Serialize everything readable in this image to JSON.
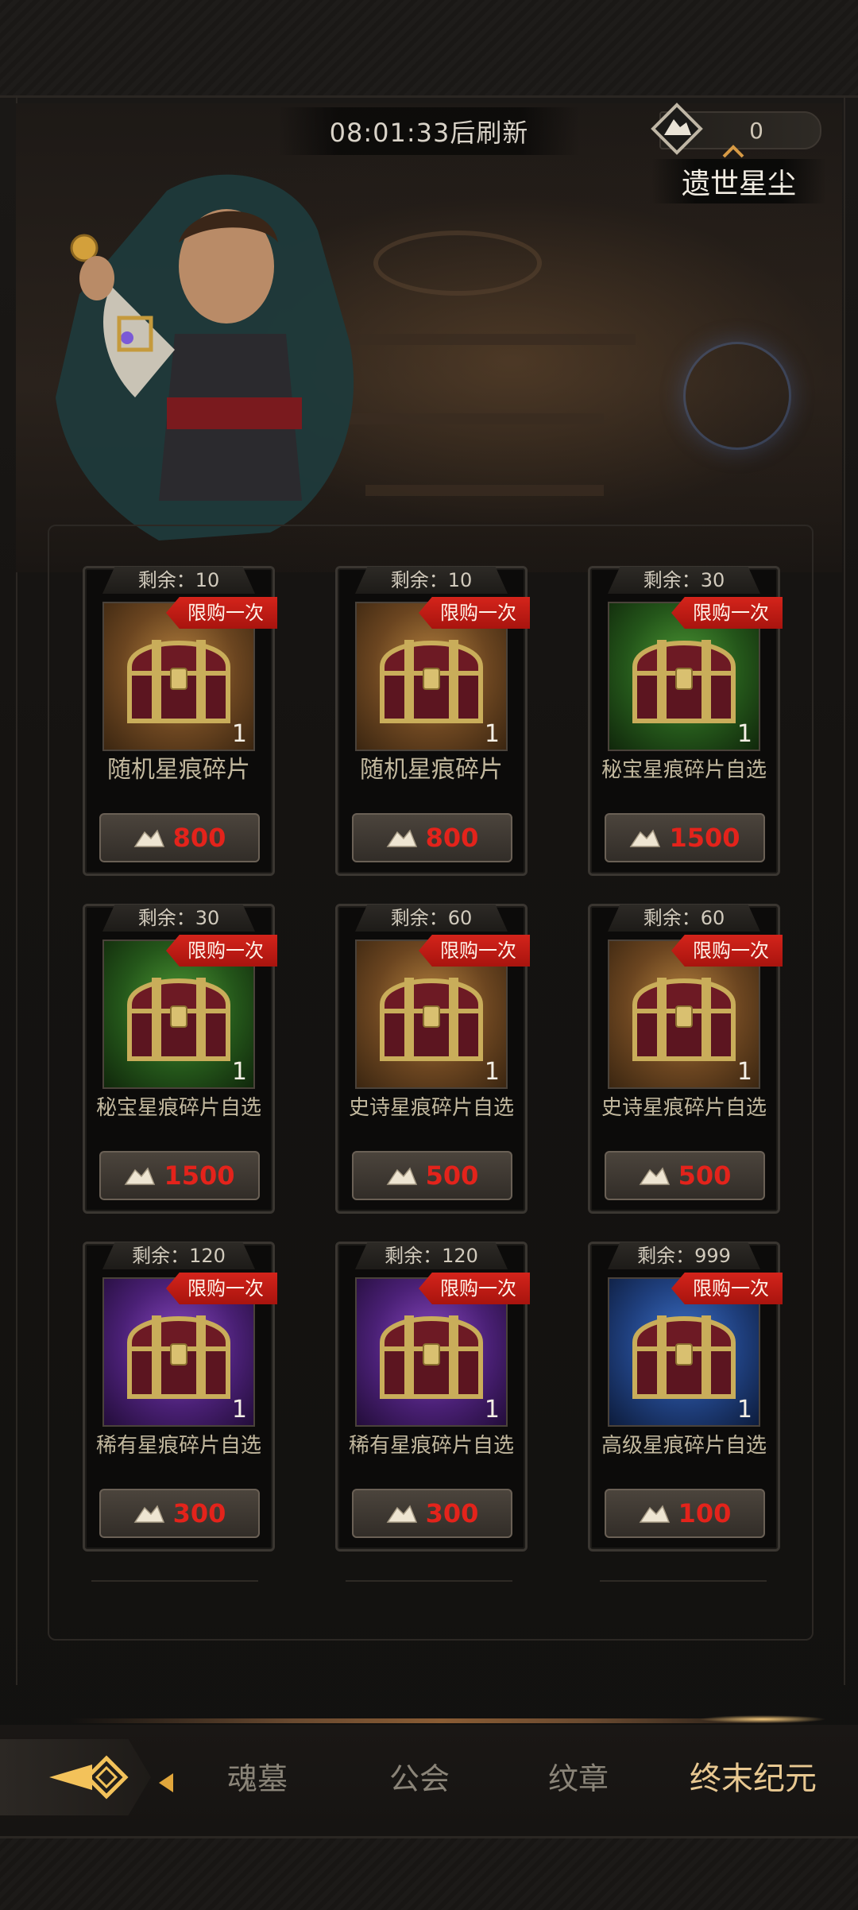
{
  "header": {
    "refresh_timer": "08:01:33后刷新",
    "currency": {
      "name": "遗世星尘",
      "value": "0",
      "icon": "stardust-icon"
    }
  },
  "shop_items": [
    {
      "remain": "剩余：10",
      "limit": "限购一次",
      "name": "随机星痕碎片",
      "qty": "1",
      "price": "800",
      "rarity": "orange"
    },
    {
      "remain": "剩余：10",
      "limit": "限购一次",
      "name": "随机星痕碎片",
      "qty": "1",
      "price": "800",
      "rarity": "orange"
    },
    {
      "remain": "剩余：30",
      "limit": "限购一次",
      "name": "秘宝星痕碎片自选",
      "qty": "1",
      "price": "1500",
      "rarity": "green"
    },
    {
      "remain": "剩余：30",
      "limit": "限购一次",
      "name": "秘宝星痕碎片自选",
      "qty": "1",
      "price": "1500",
      "rarity": "green"
    },
    {
      "remain": "剩余：60",
      "limit": "限购一次",
      "name": "史诗星痕碎片自选",
      "qty": "1",
      "price": "500",
      "rarity": "orange"
    },
    {
      "remain": "剩余：60",
      "limit": "限购一次",
      "name": "史诗星痕碎片自选",
      "qty": "1",
      "price": "500",
      "rarity": "orange"
    },
    {
      "remain": "剩余：120",
      "limit": "限购一次",
      "name": "稀有星痕碎片自选",
      "qty": "1",
      "price": "300",
      "rarity": "purple"
    },
    {
      "remain": "剩余：120",
      "limit": "限购一次",
      "name": "稀有星痕碎片自选",
      "qty": "1",
      "price": "300",
      "rarity": "purple"
    },
    {
      "remain": "剩余：999",
      "limit": "限购一次",
      "name": "高级星痕碎片自选",
      "qty": "1",
      "price": "100",
      "rarity": "blue"
    }
  ],
  "bottom_nav": {
    "tabs": [
      {
        "label": "魂墓"
      },
      {
        "label": "公会"
      },
      {
        "label": "纹章"
      },
      {
        "label": "终末纪元"
      }
    ],
    "active_tab": "终末纪元"
  },
  "colors": {
    "price_red": "#e3231b",
    "limit_ribbon": "#d4241b",
    "active_tab": "#e8c891"
  }
}
